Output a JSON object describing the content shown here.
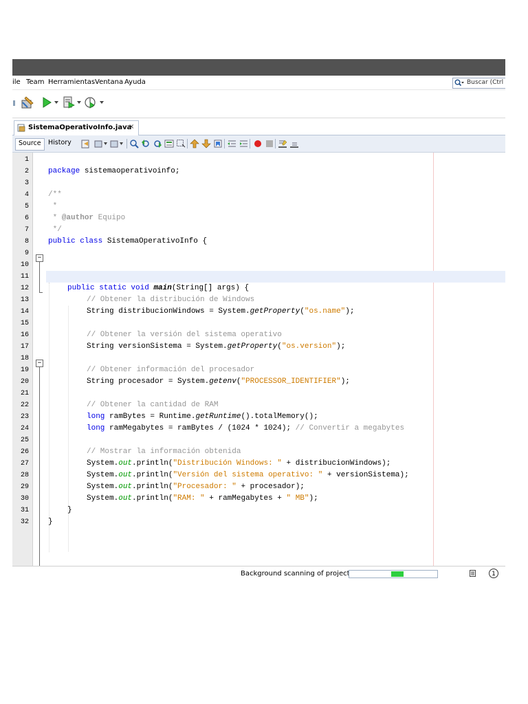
{
  "menu": {
    "items": [
      "ile",
      "Team",
      "Herramientas",
      "Ventana",
      "Ayuda"
    ],
    "search_placeholder": "Buscar (Ctrl"
  },
  "editor_tab": {
    "filename": "SistemaOperativoInfo.java",
    "close": "×"
  },
  "editor_toolbar": {
    "source_label": "Source",
    "history_label": "History"
  },
  "code": {
    "line_numbers": [
      "1",
      "2",
      "3",
      "4",
      "5",
      "6",
      "7",
      "8",
      "9",
      "10",
      "11",
      "12",
      "13",
      "14",
      "15",
      "16",
      "17",
      "18",
      "19",
      "20",
      "21",
      "22",
      "23",
      "24",
      "25",
      "26",
      "27",
      "28",
      "29",
      "30",
      "31",
      "32"
    ],
    "l2": {
      "kw": "package",
      "rest": " sistemaoperativoinfo;"
    },
    "l4": "/**",
    "l5": " *",
    "l6": {
      "pre": " * ",
      "tag": "@author",
      "rest": " Equipo"
    },
    "l7": " */",
    "l8": {
      "kw": "public class",
      "rest": " SistemaOperativoInfo {"
    },
    "l12": {
      "kw": "public static void",
      "sp": " ",
      "method": "main",
      "rest": "(String[] args) {"
    },
    "l13": "// Obtener la distribución de Windows",
    "l14": {
      "pre": "String distribucionWindows = System.",
      "method": "getProperty",
      "open": "(",
      "str": "\"os.name\"",
      "close": ");"
    },
    "l16": "// Obtener la versión del sistema operativo",
    "l17": {
      "pre": "String versionSistema = System.",
      "method": "getProperty",
      "open": "(",
      "str": "\"os.version\"",
      "close": ");"
    },
    "l19": "// Obtener información del procesador",
    "l20": {
      "pre": "String procesador = System.",
      "method": "getenv",
      "open": "(",
      "str": "\"PROCESSOR_IDENTIFIER\"",
      "close": ");"
    },
    "l22": "// Obtener la cantidad de RAM",
    "l23": {
      "kw": "long",
      "pre": " ramBytes = Runtime.",
      "method": "getRuntime",
      "rest": "().totalMemory();"
    },
    "l24": {
      "kw": "long",
      "rest": " ramMegabytes = ramBytes / (1024 * 1024); ",
      "comment": "// Convertir a megabytes"
    },
    "l26": "// Mostrar la información obtenida",
    "l27": {
      "pre": "System.",
      "field": "out",
      "mid": ".println(",
      "str": "\"Distribución Windows: \"",
      "rest": " + distribucionWindows);"
    },
    "l28": {
      "pre": "System.",
      "field": "out",
      "mid": ".println(",
      "str": "\"Versión del sistema operativo: \"",
      "rest": " + versionSistema);"
    },
    "l29": {
      "pre": "System.",
      "field": "out",
      "mid": ".println(",
      "str": "\"Procesador: \"",
      "rest": " + procesador);"
    },
    "l30": {
      "pre": "System.",
      "field": "out",
      "mid": ".println(",
      "str": "\"RAM: \"",
      "mid2": " + ramMegabytes + ",
      "str2": "\" MB\"",
      "rest": ");"
    },
    "l31": "}",
    "l32": "}"
  },
  "status": {
    "text": "Background scanning of projects...",
    "progress_fraction": 0.14,
    "notification_count": "1"
  },
  "colors": {
    "keyword": "#0000e6",
    "comment": "#969696",
    "string": "#ce7b00",
    "field": "#009900",
    "progress": "#2ecf3f"
  }
}
